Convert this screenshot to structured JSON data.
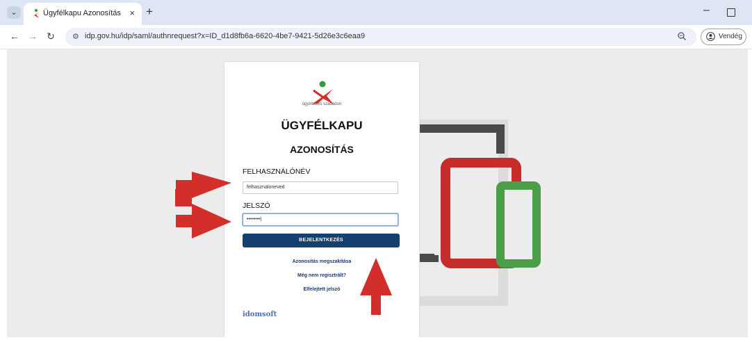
{
  "browser": {
    "tab_title": "Ügyfélkapu Azonosítás",
    "tab_close": "×",
    "new_tab": "+",
    "url": "idp.gov.hu/idp/saml/authnrequest?x=ID_d1d8fb6a-6620-4be7-9421-5d26e3c6eaa9",
    "guest_label": "Vendég",
    "icons": [
      "tab-search-icon",
      "back-icon",
      "forward-icon",
      "reload-icon",
      "site-info-icon",
      "zoom-icon",
      "person-icon"
    ]
  },
  "login": {
    "tagline": "ügyintézés szabadon",
    "title": "ÜGYFÉLKAPU",
    "subtitle": "AZONOSÍTÁS",
    "username_label": "FELHASZNÁLÓNÉV",
    "username_value": "felhasznaloneved",
    "password_label": "JELSZÓ",
    "password_value": "••••••••|",
    "login_button": "BEJELENTKEZÉS",
    "cancel_link": "Azonosítás megszakítása",
    "register_link": "Még nem regisztrált?",
    "forgot_link": "Elfelejtett jelszó",
    "brand": "idomsoft"
  },
  "colors": {
    "button": "#143f6f",
    "arrow": "#d32f2a",
    "device_red": "#c62d2a",
    "device_green": "#4a9e47",
    "device_dark": "#4a4a4a"
  }
}
